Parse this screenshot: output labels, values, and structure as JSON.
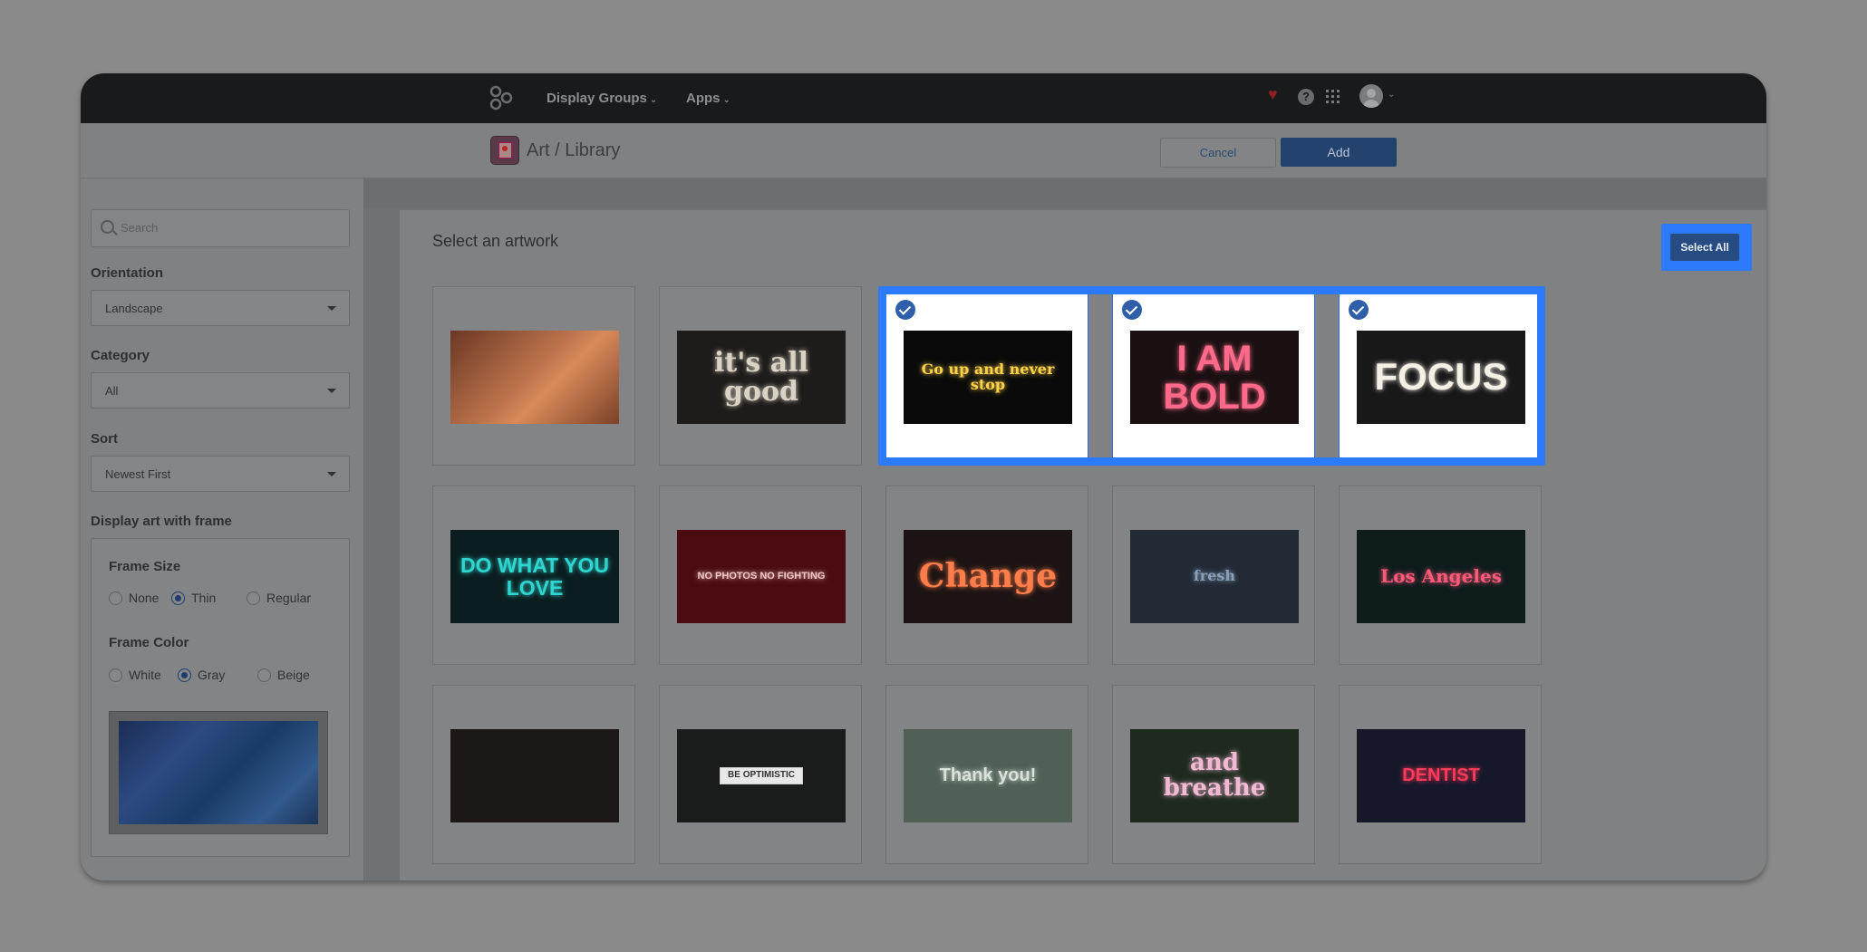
{
  "nav": {
    "display_groups": "Display Groups",
    "apps": "Apps"
  },
  "header": {
    "breadcrumb": "Art / Library",
    "cancel": "Cancel",
    "add": "Add"
  },
  "sidebar": {
    "search_placeholder": "Search",
    "orientation": {
      "label": "Orientation",
      "value": "Landscape"
    },
    "category": {
      "label": "Category",
      "value": "All"
    },
    "sort": {
      "label": "Sort",
      "value": "Newest First"
    },
    "frame_section": "Display art with frame",
    "frame_size": {
      "label": "Frame Size",
      "options": [
        "None",
        "Thin",
        "Regular"
      ],
      "selected": "Thin"
    },
    "frame_color": {
      "label": "Frame Color",
      "options": [
        "White",
        "Gray",
        "Beige"
      ],
      "selected": "Gray"
    }
  },
  "main": {
    "title": "Select an artwork",
    "select_all": "Select All",
    "artworks": [
      {
        "text": "",
        "selected": false,
        "bg": "#a05a3a"
      },
      {
        "text": "it's all good",
        "selected": false,
        "bg": "#1e1c1a"
      },
      {
        "text": "Go up and never stop",
        "selected": true,
        "bg": "#0a0a0a"
      },
      {
        "text": "I AM BOLD",
        "selected": true,
        "bg": "#1a1012"
      },
      {
        "text": "FOCUS",
        "selected": true,
        "bg": "#181818"
      },
      {
        "text": "DO WHAT YOU LOVE",
        "selected": false,
        "bg": "#0b1d1f"
      },
      {
        "text": "NO PHOTOS NO FIGHTING",
        "selected": false,
        "bg": "#4a0c10"
      },
      {
        "text": "Change",
        "selected": false,
        "bg": "#1c1414"
      },
      {
        "text": "fresh",
        "selected": false,
        "bg": "#222a36"
      },
      {
        "text": "Los Angeles",
        "selected": false,
        "bg": "#0e1c1c"
      },
      {
        "text": "",
        "selected": false,
        "bg": "#1c1818"
      },
      {
        "text": "BE OPTIMISTIC",
        "selected": false,
        "bg": "#1a1c1c"
      },
      {
        "text": "Thank you!",
        "selected": false,
        "bg": "#506056"
      },
      {
        "text": "and breathe",
        "selected": false,
        "bg": "#1e2a20"
      },
      {
        "text": "DENTIST",
        "selected": false,
        "bg": "#16182a"
      }
    ]
  }
}
